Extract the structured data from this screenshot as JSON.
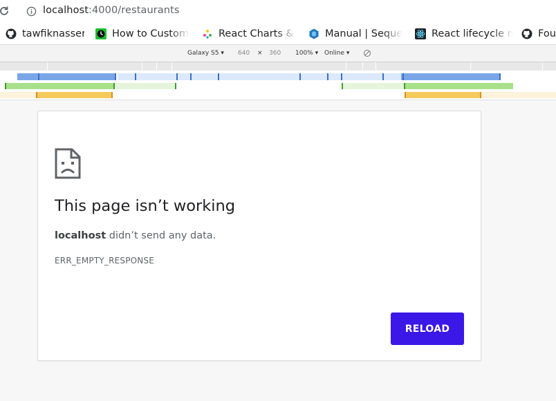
{
  "browser": {
    "url_host": "localhost",
    "url_path": ":4000/restaurants"
  },
  "bookmarks": [
    {
      "label": "tawfiknasser",
      "icon": "github-icon"
    },
    {
      "label": "How to Customi",
      "icon": "green-clock-icon"
    },
    {
      "label": "React Charts & G",
      "icon": "react-charts-icon"
    },
    {
      "label": "Manual | Sequeli",
      "icon": "sequelize-icon"
    },
    {
      "label": "React lifecycle m",
      "icon": "react-icon"
    },
    {
      "label": "Fou",
      "icon": "github-icon"
    }
  ],
  "device_toolbar": {
    "device": "Galaxy S5",
    "width": "640",
    "separator": "×",
    "height": "360",
    "zoom": "100%",
    "network": "Online"
  },
  "error": {
    "title": "This page isn’t working",
    "host": "localhost",
    "message": " didn’t send any data.",
    "code": "ERR_EMPTY_RESPONSE",
    "reload_label": "RELOAD"
  },
  "colors": {
    "reload_button": "#3b18e8",
    "timeline_blue": "#7aa6e8",
    "timeline_green": "#a8e08a",
    "timeline_orange": "#f5c95c"
  }
}
